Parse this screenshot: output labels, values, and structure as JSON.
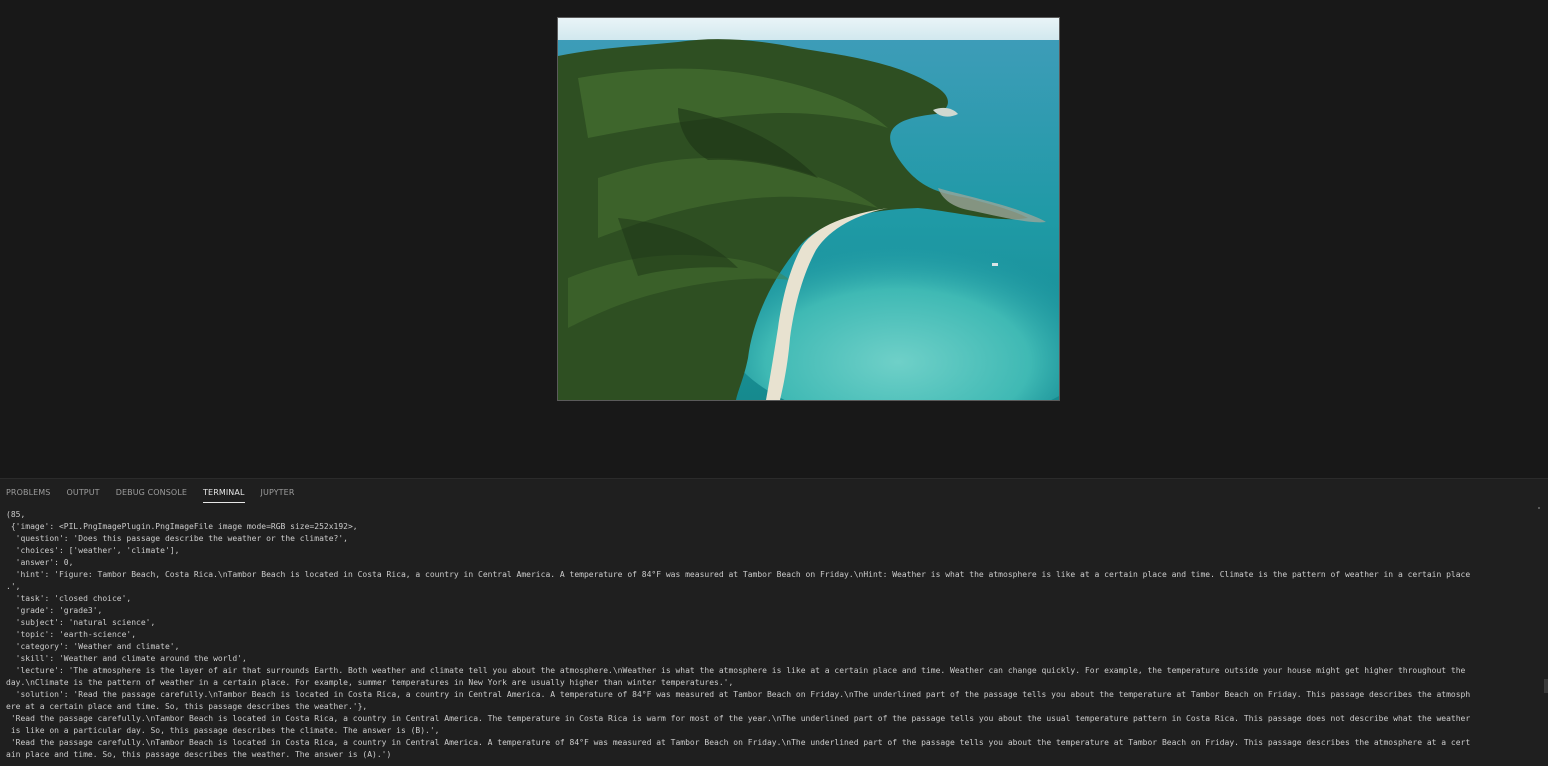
{
  "panel": {
    "tabs": [
      {
        "label": "PROBLEMS"
      },
      {
        "label": "OUTPUT"
      },
      {
        "label": "DEBUG CONSOLE"
      },
      {
        "label": "TERMINAL"
      },
      {
        "label": "JUPYTER"
      }
    ],
    "active_tab": "TERMINAL"
  },
  "terminal": {
    "lines": [
      "(85,",
      " {'image': <PIL.PngImagePlugin.PngImageFile image mode=RGB size=252x192>,",
      "  'question': 'Does this passage describe the weather or the climate?',",
      "  'choices': ['weather', 'climate'],",
      "  'answer': 0,",
      "  'hint': 'Figure: Tambor Beach, Costa Rica.\\nTambor Beach is located in Costa Rica, a country in Central America. A temperature of 84°F was measured at Tambor Beach on Friday.\\nHint: Weather is what the atmosphere is like at a certain place and time. Climate is the pattern of weather in a certain place",
      ".',",
      "  'task': 'closed choice',",
      "  'grade': 'grade3',",
      "  'subject': 'natural science',",
      "  'topic': 'earth-science',",
      "  'category': 'Weather and climate',",
      "  'skill': 'Weather and climate around the world',",
      "  'lecture': 'The atmosphere is the layer of air that surrounds Earth. Both weather and climate tell you about the atmosphere.\\nWeather is what the atmosphere is like at a certain place and time. Weather can change quickly. For example, the temperature outside your house might get higher throughout the",
      "day.\\nClimate is the pattern of weather in a certain place. For example, summer temperatures in New York are usually higher than winter temperatures.',",
      "  'solution': 'Read the passage carefully.\\nTambor Beach is located in Costa Rica, a country in Central America. A temperature of 84°F was measured at Tambor Beach on Friday.\\nThe underlined part of the passage tells you about the temperature at Tambor Beach on Friday. This passage describes the atmosph",
      "ere at a certain place and time. So, this passage describes the weather.'},",
      " 'Read the passage carefully.\\nTambor Beach is located in Costa Rica, a country in Central America. The temperature in Costa Rica is warm for most of the year.\\nThe underlined part of the passage tells you about the usual temperature pattern in Costa Rica. This passage does not describe what the weather",
      " is like on a particular day. So, this passage describes the climate. The answer is (B).',",
      " 'Read the passage carefully.\\nTambor Beach is located in Costa Rica, a country in Central America. A temperature of 84°F was measured at Tambor Beach on Friday.\\nThe underlined part of the passage tells you about the temperature at Tambor Beach on Friday. This passage describes the atmosphere at a cert",
      "ain place and time. So, this passage describes the weather. The answer is (A).')"
    ]
  },
  "image": {
    "colors": {
      "sky": "#dfeef2",
      "sea": "#1f9aa6",
      "shallow": "#4cc3c0",
      "forest": "#2e4f22",
      "forest_light": "#4d7a35",
      "sand": "#e8e2d0"
    }
  }
}
